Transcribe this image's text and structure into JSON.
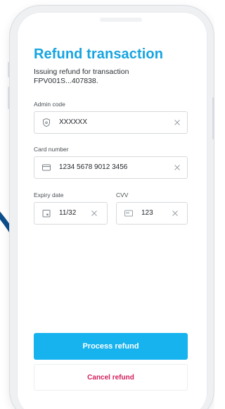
{
  "header": {
    "title": "Refund transaction",
    "subtitle": "Issuing refund for transaction FPV001S...407838."
  },
  "form": {
    "admin_code": {
      "label": "Admin code",
      "value": "XXXXXX",
      "icon": "shield-icon"
    },
    "card_number": {
      "label": "Card number",
      "value": "1234 5678 9012 3456",
      "icon": "credit-card-icon"
    },
    "expiry_date": {
      "label": "Expiry date",
      "value": "11/32",
      "icon": "calendar-icon"
    },
    "cvv": {
      "label": "CVV",
      "value": "123",
      "icon": "card-cvv-icon"
    }
  },
  "actions": {
    "process_label": "Process refund",
    "cancel_label": "Cancel refund"
  },
  "colors": {
    "title": "#16a4e0",
    "primary_button": "#17b3ee",
    "cancel_text": "#d21f5a",
    "swoosh": "#0d4f8c"
  }
}
